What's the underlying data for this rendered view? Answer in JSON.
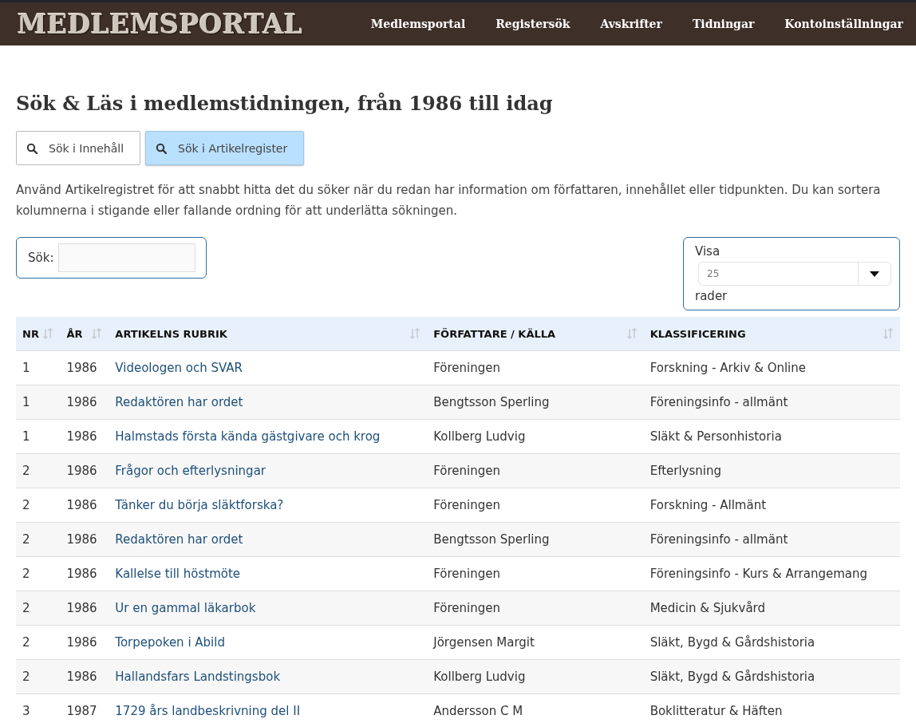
{
  "header": {
    "logo": "MEDLEMSPORTAL",
    "nav": [
      "Medlemsportal",
      "Registersök",
      "Avskrifter",
      "Tidningar",
      "Kontoinställningar"
    ]
  },
  "title": "Sök & Läs i medlemstidningen, från 1986 till idag",
  "tabs": [
    {
      "label": "Sök i Innehåll",
      "selected": false
    },
    {
      "label": "Sök i Artikelregister",
      "selected": true
    }
  ],
  "description": "Använd Artikelregistret för att snabbt hitta det du söker när du redan har information om författaren, innehållet eller tidpunkten. Du kan sortera kolumnerna i stigande eller fallande ordning för att underlätta sökningen.",
  "search": {
    "label": "Sök:"
  },
  "page_size": {
    "label_before": "Visa",
    "value": "25",
    "label_after": "rader"
  },
  "table": {
    "columns": [
      "NR",
      "ÅR",
      "ARTIKELNS RUBRIK",
      "FÖRFATTARE / KÄLLA",
      "KLASSIFICERING"
    ],
    "rows": [
      [
        "1",
        "1986",
        "Videologen och SVAR",
        "Föreningen",
        "Forskning - Arkiv & Online"
      ],
      [
        "1",
        "1986",
        "Redaktören har ordet",
        "Bengtsson Sperling",
        "Föreningsinfo - allmänt"
      ],
      [
        "1",
        "1986",
        "Halmstads första kända gästgivare och krog",
        "Kollberg Ludvig",
        "Släkt & Personhistoria"
      ],
      [
        "2",
        "1986",
        "Frågor och efterlysningar",
        "Föreningen",
        "Efterlysning"
      ],
      [
        "2",
        "1986",
        "Tänker du börja släktforska?",
        "Föreningen",
        "Forskning - Allmänt"
      ],
      [
        "2",
        "1986",
        "Redaktören har ordet",
        "Bengtsson Sperling",
        "Föreningsinfo - allmänt"
      ],
      [
        "2",
        "1986",
        "Kallelse till höstmöte",
        "Föreningen",
        "Föreningsinfo - Kurs & Arrangemang"
      ],
      [
        "2",
        "1986",
        "Ur en gammal läkarbok",
        "Föreningen",
        "Medicin & Sjukvård"
      ],
      [
        "2",
        "1986",
        "Torpepoken i Abild",
        "Jörgensen Margit",
        "Släkt, Bygd & Gårdshistoria"
      ],
      [
        "2",
        "1986",
        "Hallandsfars Landstingsbok",
        "Kollberg Ludvig",
        "Släkt, Bygd & Gårdshistoria"
      ],
      [
        "3",
        "1987",
        "1729 års landbeskrivning del II",
        "Andersson C M",
        "Boklitteratur & Häften"
      ]
    ]
  }
}
